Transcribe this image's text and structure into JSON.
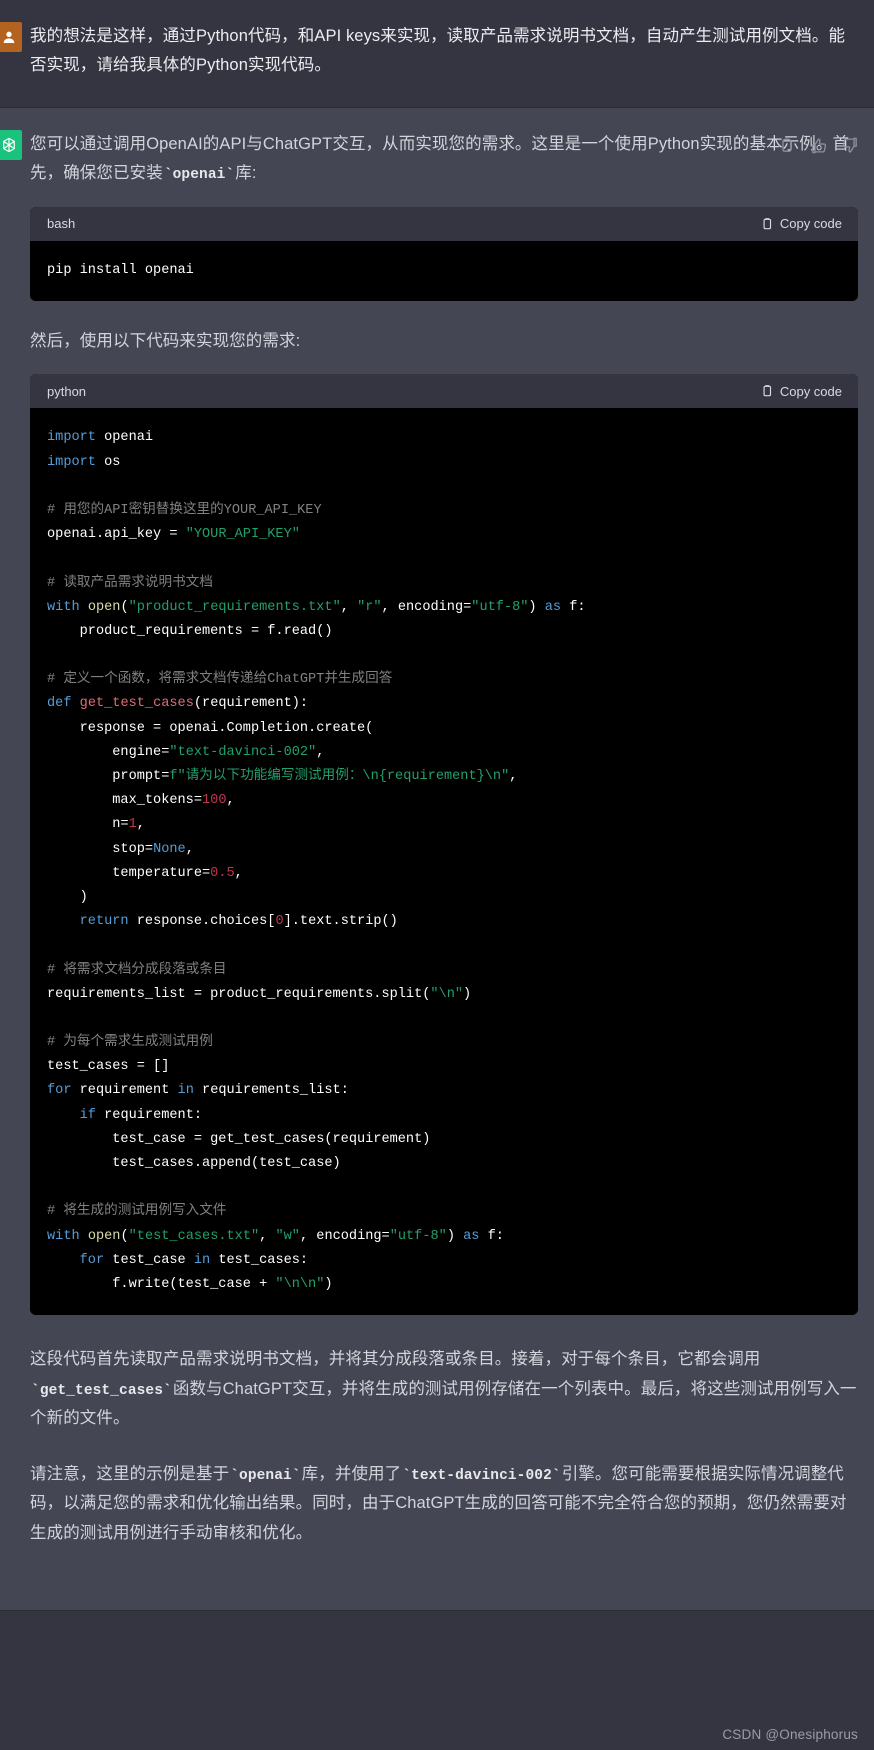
{
  "messages": [
    {
      "role": "user",
      "avatar_icon": "user-avatar-icon",
      "paragraphs": [
        "我的想法是这样，通过Python代码，和API keys来实现，读取产品需求说明书文档，自动产生测试用例文档。能否实现，请给我具体的Python实现代码。"
      ]
    },
    {
      "role": "assistant",
      "avatar_icon": "chatgpt-logo-icon",
      "intro_before_code": "您可以通过调用OpenAI的API与ChatGPT交互，从而实现您的需求。这里是一个使用Python实现的基本示例。首先，确保您已安装",
      "intro_inline_code": "openai",
      "intro_after_code": "库:",
      "bash_block": {
        "lang": "bash",
        "copy_label": "Copy code",
        "copy_icon": "clipboard-icon",
        "code": "pip install openai"
      },
      "mid_text": "然后，使用以下代码来实现您的需求:",
      "python_block": {
        "lang": "python",
        "copy_label": "Copy code",
        "copy_icon": "clipboard-icon"
      },
      "closing_paragraph_1_a": "这段代码首先读取产品需求说明书文档，并将其分成段落或条目。接着，对于每个条目，它都会调用",
      "closing_paragraph_1_code": "get_test_cases",
      "closing_paragraph_1_b": "函数与ChatGPT交互，并将生成的测试用例存储在一个列表中。最后，将这些测试用例写入一个新的文件。",
      "closing_paragraph_2_a": "请注意，这里的示例是基于",
      "closing_paragraph_2_code1": "openai",
      "closing_paragraph_2_b": "库，并使用了",
      "closing_paragraph_2_code2": "text-davinci-002",
      "closing_paragraph_2_c": "引擎。您可能需要根据实际情况调整代码，以满足您的需求和优化输出结果。同时，由于ChatGPT生成的回答可能不完全符合您的预期，您仍然需要对生成的测试用例进行手动审核和优化。",
      "actions": [
        {
          "name": "copy-message-icon",
          "label": "clipboard"
        },
        {
          "name": "thumbs-up-icon",
          "label": "thumbs-up"
        },
        {
          "name": "thumbs-down-icon",
          "label": "thumbs-down"
        }
      ]
    }
  ],
  "code_python_lines": [
    [
      {
        "t": "kw",
        "s": "import"
      },
      {
        "t": "pl",
        "s": " openai"
      }
    ],
    [
      {
        "t": "kw",
        "s": "import"
      },
      {
        "t": "pl",
        "s": " os"
      }
    ],
    [],
    [
      {
        "t": "com",
        "s": "# 用您的API密钥替换这里的YOUR_API_KEY"
      }
    ],
    [
      {
        "t": "pl",
        "s": "openai.api_key = "
      },
      {
        "t": "str",
        "s": "\"YOUR_API_KEY\""
      }
    ],
    [],
    [
      {
        "t": "com",
        "s": "# 读取产品需求说明书文档"
      }
    ],
    [
      {
        "t": "kw",
        "s": "with"
      },
      {
        "t": "pl",
        "s": " "
      },
      {
        "t": "fn",
        "s": "open"
      },
      {
        "t": "pl",
        "s": "("
      },
      {
        "t": "str",
        "s": "\"product_requirements.txt\""
      },
      {
        "t": "pl",
        "s": ", "
      },
      {
        "t": "str",
        "s": "\"r\""
      },
      {
        "t": "pl",
        "s": ", encoding="
      },
      {
        "t": "str",
        "s": "\"utf-8\""
      },
      {
        "t": "pl",
        "s": ") "
      },
      {
        "t": "kw",
        "s": "as"
      },
      {
        "t": "pl",
        "s": " f:"
      }
    ],
    [
      {
        "t": "pl",
        "s": "    product_requirements = f.read()"
      }
    ],
    [],
    [
      {
        "t": "com",
        "s": "# 定义一个函数，将需求文档传递给ChatGPT并生成回答"
      }
    ],
    [
      {
        "t": "kw",
        "s": "def"
      },
      {
        "t": "pl",
        "s": " "
      },
      {
        "t": "def",
        "s": "get_test_cases"
      },
      {
        "t": "pl",
        "s": "(requirement):"
      }
    ],
    [
      {
        "t": "pl",
        "s": "    response = openai.Completion.create("
      }
    ],
    [
      {
        "t": "pl",
        "s": "        engine="
      },
      {
        "t": "str",
        "s": "\"text-davinci-002\""
      },
      {
        "t": "pl",
        "s": ","
      }
    ],
    [
      {
        "t": "pl",
        "s": "        prompt="
      },
      {
        "t": "str",
        "s": "f\"请为以下功能编写测试用例：\\n{requirement}\\n\""
      },
      {
        "t": "pl",
        "s": ","
      }
    ],
    [
      {
        "t": "pl",
        "s": "        max_tokens="
      },
      {
        "t": "num",
        "s": "100"
      },
      {
        "t": "pl",
        "s": ","
      }
    ],
    [
      {
        "t": "pl",
        "s": "        n="
      },
      {
        "t": "num",
        "s": "1"
      },
      {
        "t": "pl",
        "s": ","
      }
    ],
    [
      {
        "t": "pl",
        "s": "        stop="
      },
      {
        "t": "kw",
        "s": "None"
      },
      {
        "t": "pl",
        "s": ","
      }
    ],
    [
      {
        "t": "pl",
        "s": "        temperature="
      },
      {
        "t": "num",
        "s": "0.5"
      },
      {
        "t": "pl",
        "s": ","
      }
    ],
    [
      {
        "t": "pl",
        "s": "    )"
      }
    ],
    [
      {
        "t": "pl",
        "s": "    "
      },
      {
        "t": "kw",
        "s": "return"
      },
      {
        "t": "pl",
        "s": " response.choices["
      },
      {
        "t": "num",
        "s": "0"
      },
      {
        "t": "pl",
        "s": "].text.strip()"
      }
    ],
    [],
    [
      {
        "t": "com",
        "s": "# 将需求文档分成段落或条目"
      }
    ],
    [
      {
        "t": "pl",
        "s": "requirements_list = product_requirements.split("
      },
      {
        "t": "str",
        "s": "\"\\n\""
      },
      {
        "t": "pl",
        "s": ")"
      }
    ],
    [],
    [
      {
        "t": "com",
        "s": "# 为每个需求生成测试用例"
      }
    ],
    [
      {
        "t": "pl",
        "s": "test_cases = []"
      }
    ],
    [
      {
        "t": "kw",
        "s": "for"
      },
      {
        "t": "pl",
        "s": " requirement "
      },
      {
        "t": "kw",
        "s": "in"
      },
      {
        "t": "pl",
        "s": " requirements_list:"
      }
    ],
    [
      {
        "t": "pl",
        "s": "    "
      },
      {
        "t": "kw",
        "s": "if"
      },
      {
        "t": "pl",
        "s": " requirement:"
      }
    ],
    [
      {
        "t": "pl",
        "s": "        test_case = get_test_cases(requirement)"
      }
    ],
    [
      {
        "t": "pl",
        "s": "        test_cases.append(test_case)"
      }
    ],
    [],
    [
      {
        "t": "com",
        "s": "# 将生成的测试用例写入文件"
      }
    ],
    [
      {
        "t": "kw",
        "s": "with"
      },
      {
        "t": "pl",
        "s": " "
      },
      {
        "t": "fn",
        "s": "open"
      },
      {
        "t": "pl",
        "s": "("
      },
      {
        "t": "str",
        "s": "\"test_cases.txt\""
      },
      {
        "t": "pl",
        "s": ", "
      },
      {
        "t": "str",
        "s": "\"w\""
      },
      {
        "t": "pl",
        "s": ", encoding="
      },
      {
        "t": "str",
        "s": "\"utf-8\""
      },
      {
        "t": "pl",
        "s": ") "
      },
      {
        "t": "kw",
        "s": "as"
      },
      {
        "t": "pl",
        "s": " f:"
      }
    ],
    [
      {
        "t": "pl",
        "s": "    "
      },
      {
        "t": "kw",
        "s": "for"
      },
      {
        "t": "pl",
        "s": " test_case "
      },
      {
        "t": "kw",
        "s": "in"
      },
      {
        "t": "pl",
        "s": " test_cases:"
      }
    ],
    [
      {
        "t": "pl",
        "s": "        f.write(test_case + "
      },
      {
        "t": "str",
        "s": "\"\\n\\n\""
      },
      {
        "t": "pl",
        "s": ")"
      }
    ]
  ],
  "watermark": "CSDN @Onesiphorus",
  "colors": {
    "user_bg": "#343541",
    "assistant_bg": "#444654",
    "code_bg": "#000000",
    "code_head_bg": "#343541",
    "accent_green": "#19c37d",
    "avatar_user": "#b4621f",
    "string": "#22a06b",
    "keyword": "#569cd6",
    "comment": "#808080",
    "number": "#c0344f",
    "def_name": "#e06c75",
    "builtin": "#dcdcaa"
  }
}
